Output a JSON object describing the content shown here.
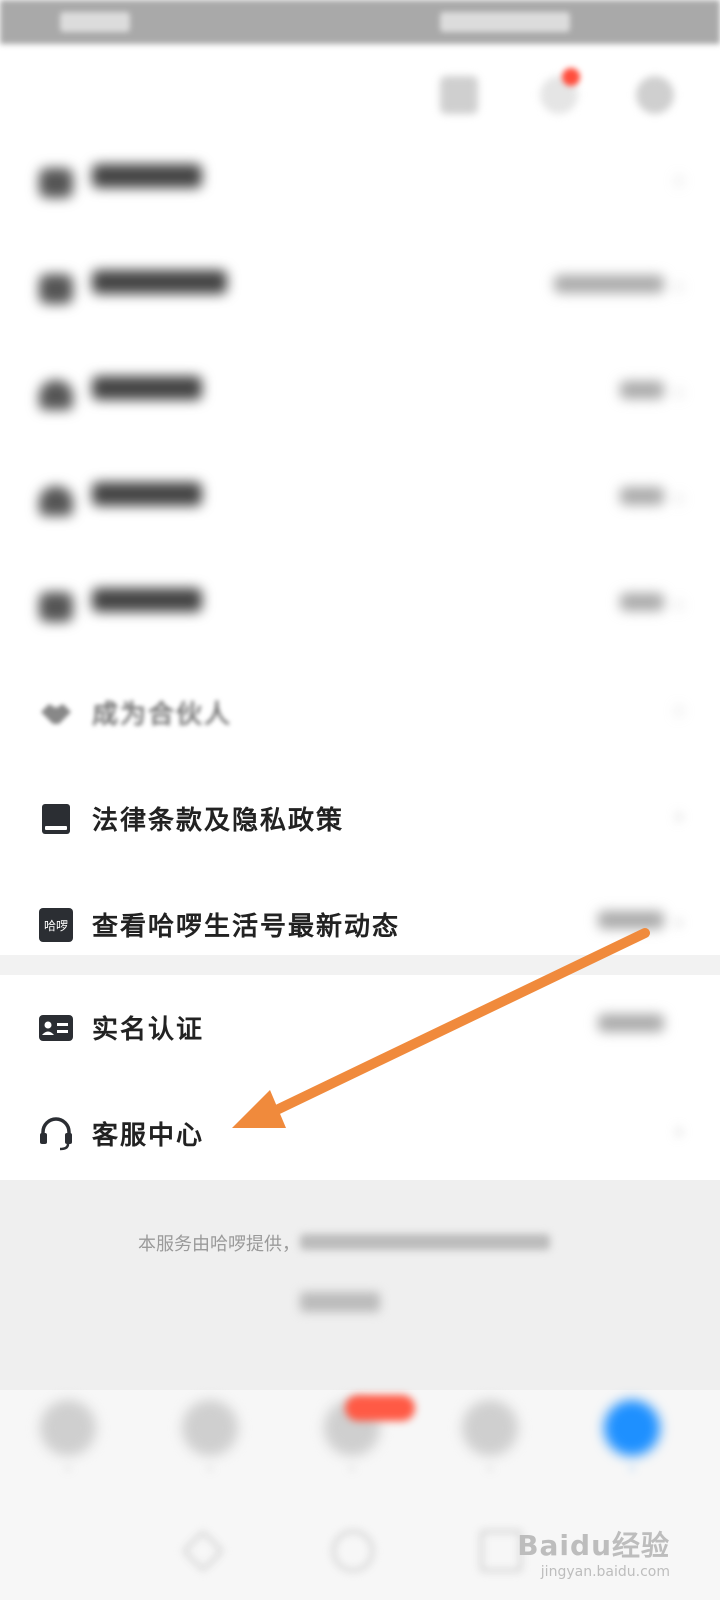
{
  "menu": {
    "items": [
      {
        "label": "法律条款及隐私政策",
        "icon": "book-icon"
      },
      {
        "label": "查看哈啰生活号最新动态",
        "icon": "hello-logo-icon",
        "icon_text": "哈啰"
      }
    ],
    "partner": {
      "label": "成为合伙人",
      "icon": "handshake-icon"
    }
  },
  "section2": {
    "items": [
      {
        "label": "实名认证",
        "icon": "id-card-icon"
      },
      {
        "label": "客服中心",
        "icon": "headset-icon"
      }
    ]
  },
  "footer": {
    "service_text": "本服务由哈啰提供，"
  },
  "watermark": {
    "main": "Baidu经验",
    "sub": "jingyan.baidu.com"
  },
  "colors": {
    "arrow": "#f08a3c",
    "accent": "#1e90ff",
    "badge": "#ff5a45"
  }
}
